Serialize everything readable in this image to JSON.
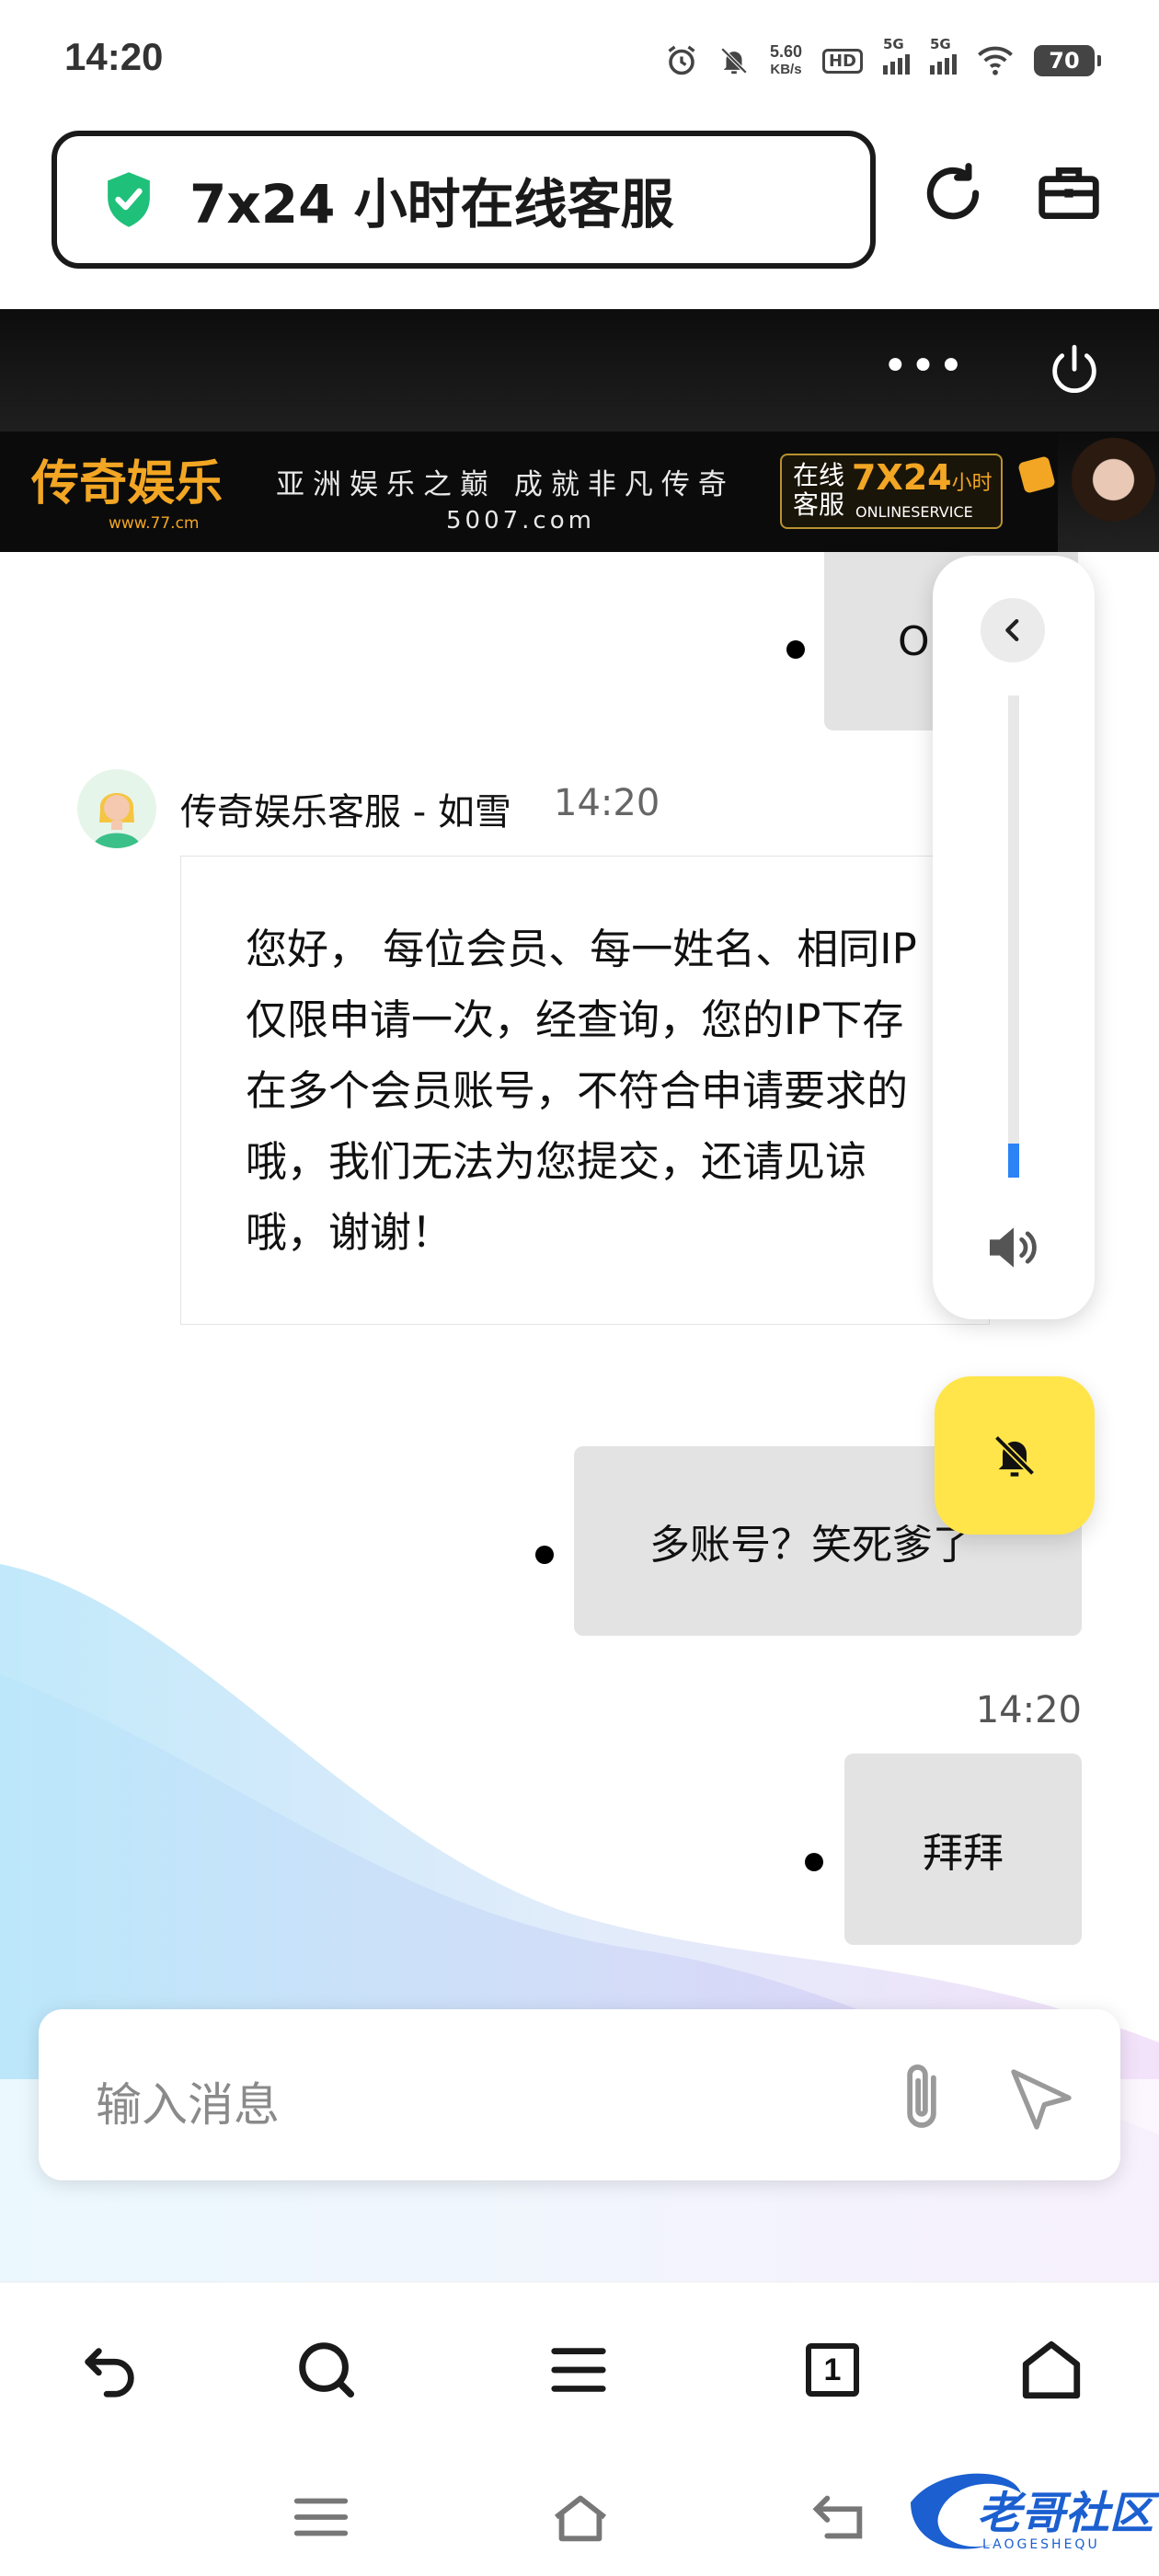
{
  "status_bar": {
    "time": "14:20",
    "net_speed_value": "5.60",
    "net_speed_unit": "KB/s",
    "hd_label": "HD",
    "network_1": "5G",
    "network_2": "5G",
    "battery": "70"
  },
  "browser": {
    "page_title": "7x24 小时在线客服"
  },
  "banner": {
    "brand_name": "传奇娱乐",
    "brand_url": "www.77.cm",
    "slogan": "亚洲娱乐之巅  成就非凡传奇",
    "slogan_url": "5007.com",
    "service_label": "在线客服",
    "service_hours": "7X24",
    "service_suffix": "小时",
    "service_en": "ONLINESERVICE"
  },
  "chat": {
    "messages": [
      {
        "direction": "out",
        "text": "O"
      },
      {
        "direction": "in",
        "sender": "传奇娱乐客服 - 如雪",
        "time": "14:20",
        "text": "您好， 每位会员、每一姓名、相同IP仅限申请一次，经查询，您的IP下存在多个会员账号，不符合申请要求的哦，我们无法为您提交，还请见谅哦，谢谢！"
      },
      {
        "direction": "out",
        "text": "多账号？笑死爹了"
      },
      {
        "direction": "out",
        "time": "14:20",
        "text": "拜拜"
      }
    ]
  },
  "side_panel": {
    "volume_level": 0.07
  },
  "input": {
    "placeholder": "输入消息"
  },
  "toolbar": {
    "tab_count": "1"
  },
  "watermark": {
    "text": "老哥社区",
    "sub": "LAOGESHEQU"
  },
  "colors": {
    "accent_yellow": "#ffe54a",
    "banner_gold": "#f2a623",
    "shield_green": "#1fc07a",
    "volume_blue": "#2b83f6",
    "outgoing_bubble": "#e3e3e3"
  },
  "icons": [
    "alarm-icon",
    "mute-icon",
    "wifi-icon",
    "shield-check-icon",
    "refresh-icon",
    "toolbox-icon",
    "more-icon",
    "power-icon",
    "chevron-left-icon",
    "speaker-icon",
    "bell-off-icon",
    "paperclip-icon",
    "send-icon",
    "back-icon",
    "search-icon",
    "menu-icon",
    "home-icon"
  ]
}
